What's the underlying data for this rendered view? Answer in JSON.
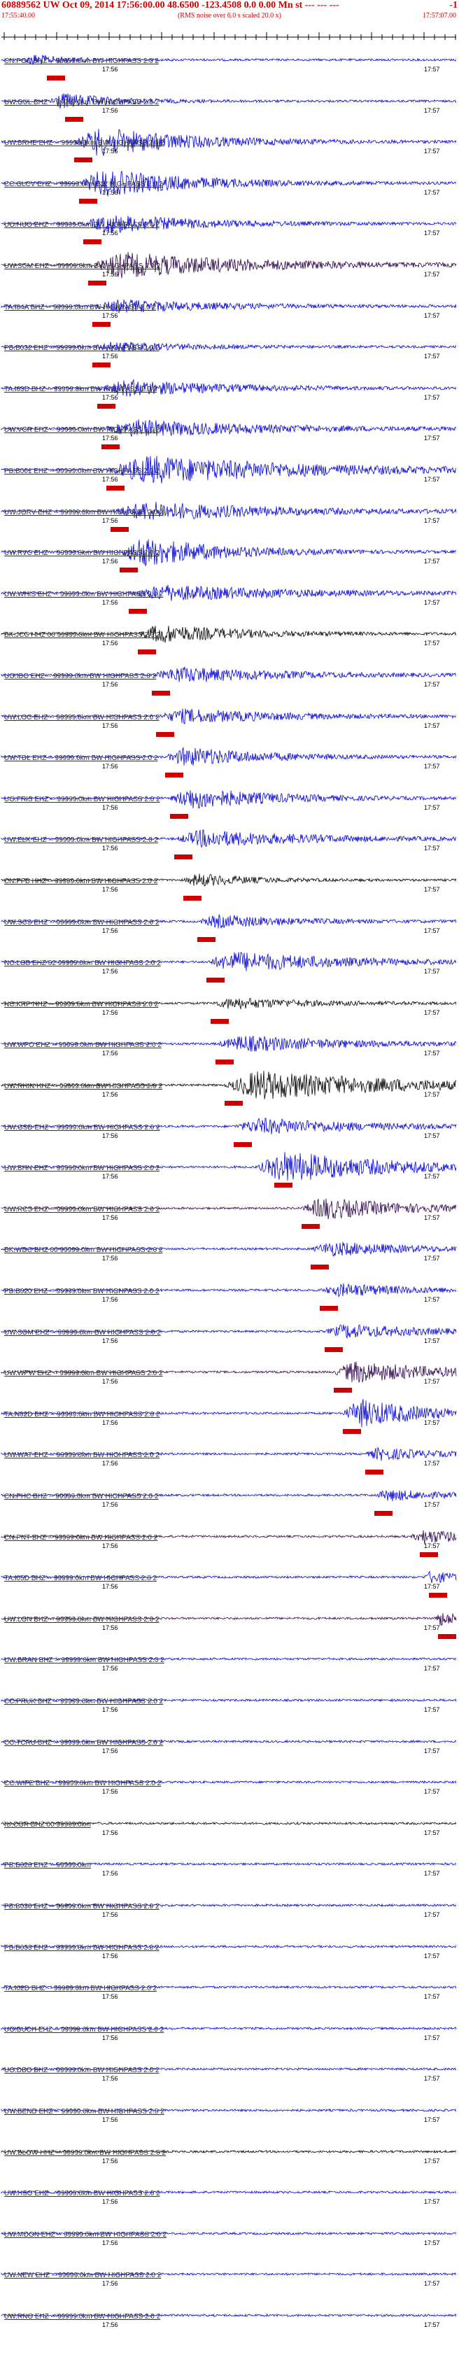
{
  "header": {
    "title": "60889562 UW Oct 09, 2014 17:56:00.00    48.6500 -123.4508   0.0 0.00 Mn st --- --- ---",
    "title_suffix": "-1",
    "start_time": "17:55:40.00",
    "end_time": "17:57:07.00",
    "subtitle": "(RMS noise over 6.0 s scaled 20.0 x)"
  },
  "tick_labels": {
    "left": "17:56",
    "right": "17:57"
  },
  "colors": {
    "blue": "#0000d8",
    "black": "#000000",
    "purple": "#2a004a",
    "red": "#d00000"
  },
  "traces": [
    {
      "label": "CN.PGC BHZ -- 99999.0km BW  HIGHPASS  2.0  2",
      "color": "blue",
      "amp": 0.35,
      "start": 0.05,
      "burst": 0.12,
      "pick": 0.1
    },
    {
      "label": "UW.GUL BHZ -- 99999.0km BW  HIGHPASS  2.0  2",
      "color": "blue",
      "amp": 0.5,
      "start": 0.1,
      "burst": 0.2,
      "pick": 0.14
    },
    {
      "label": "UW.BRHE EHZ -- 99999.0km BW  HIGHPASS  2.0  2",
      "color": "blue",
      "amp": 0.9,
      "start": 0.16,
      "burst": 0.35,
      "pick": 0.16
    },
    {
      "label": "CC.GLCV EHZ -- 99999.0km BW  HIGHPASS  2.0  2",
      "color": "blue",
      "amp": 0.85,
      "start": 0.17,
      "burst": 0.35,
      "pick": 0.17
    },
    {
      "label": "UO.HUO EHZ -- 99999.0km BW  HIGHPASS  2.0  2",
      "color": "blue",
      "amp": 0.6,
      "start": 0.18,
      "burst": 0.35,
      "pick": 0.18
    },
    {
      "label": "UW.SCM EHZ -- 99999.0km BW  HIGHPASS  2.0  2",
      "color": "purple",
      "amp": 0.8,
      "start": 0.19,
      "burst": 0.5,
      "pick": 0.19
    },
    {
      "label": "TA.I04A BHZ -- 99999.0km BW  HIGHPASS  2.0  2",
      "color": "blue",
      "amp": 0.4,
      "start": 0.2,
      "burst": 0.4,
      "pick": 0.2
    },
    {
      "label": "PB.B032 EHZ -- 99999.0km BW  HIGHPASS  2.0  2",
      "color": "blue",
      "amp": 0.3,
      "start": 0.2,
      "burst": 0.3,
      "pick": 0.2
    },
    {
      "label": "TA.I03D BHZ -- 99999.0km BW  HIGHPASS  2.0  2",
      "color": "blue",
      "amp": 0.5,
      "start": 0.21,
      "burst": 0.4,
      "pick": 0.21
    },
    {
      "label": "UW.VCR EHZ -- 99999.0km BW  HIGHPASS  2.0  2",
      "color": "blue",
      "amp": 0.55,
      "start": 0.22,
      "burst": 0.5,
      "pick": 0.22
    },
    {
      "label": "PB.B001 EHZ -- 99999.0km BW  HIGHPASS  2.0  2",
      "color": "blue",
      "amp": 0.9,
      "start": 0.23,
      "burst": 0.6,
      "pick": 0.23
    },
    {
      "label": "UW.JORV EHZ -- 99999.0km BW  HIGHPASS  2.0  2",
      "color": "blue",
      "amp": 0.6,
      "start": 0.24,
      "burst": 0.5,
      "pick": 0.24
    },
    {
      "label": "UW.RVC EHZ -- 99999.0km BW  HIGHPASS  2.0  2",
      "color": "blue",
      "amp": 0.95,
      "start": 0.26,
      "burst": 0.3,
      "pick": 0.26
    },
    {
      "label": "UW.WHIS EHZ -- 99999.0km BW  HIGHPASS  2.0  2",
      "color": "blue",
      "amp": 0.5,
      "start": 0.28,
      "burst": 0.5,
      "pick": 0.28
    },
    {
      "label": "BK.JCC HHZ 00 99999.0km BW  HIGHPASS  2.0  2",
      "color": "black",
      "amp": 0.6,
      "start": 0.3,
      "burst": 0.3,
      "pick": 0.3
    },
    {
      "label": "UO.IBO EHZ -- 99999.0km BW  HIGHPASS  2.0  2",
      "color": "blue",
      "amp": 0.5,
      "start": 0.33,
      "burst": 0.4,
      "pick": 0.33
    },
    {
      "label": "UW.LOC EHZ -- 99999.0km BW  HIGHPASS  2.0  2",
      "color": "blue",
      "amp": 0.45,
      "start": 0.34,
      "burst": 0.4,
      "pick": 0.34
    },
    {
      "label": "UW.TDL EHZ -- 99999.0km BW  HIGHPASS  2.0  2",
      "color": "blue",
      "amp": 0.6,
      "start": 0.36,
      "burst": 0.3,
      "pick": 0.36
    },
    {
      "label": "UO.FRIS EHZ -- 99999.0km BW  HIGHPASS  2.0  2",
      "color": "blue",
      "amp": 0.7,
      "start": 0.37,
      "burst": 0.3,
      "pick": 0.37
    },
    {
      "label": "UW.ELK EHZ -- 99999.0km BW  HIGHPASS  2.0  2",
      "color": "blue",
      "amp": 0.55,
      "start": 0.38,
      "burst": 0.4,
      "pick": 0.38
    },
    {
      "label": "CN.PFB HHZ -- 99999.0km BW  HIGHPASS  2.0  2",
      "color": "black",
      "amp": 0.4,
      "start": 0.4,
      "burst": 0.2,
      "pick": 0.4
    },
    {
      "label": "UW.SCS EHZ -- 99999.0km BW  HIGHPASS  2.0  2",
      "color": "blue",
      "amp": 0.4,
      "start": 0.43,
      "burst": 0.3,
      "pick": 0.43
    },
    {
      "label": "NC.LGB EHZ 02 99999.0km BW  HIGHPASS  2.0  2",
      "color": "blue",
      "amp": 0.65,
      "start": 0.45,
      "burst": 0.4,
      "pick": 0.45
    },
    {
      "label": "NC.KRP HHZ -- 99999.0km BW  HIGHPASS  2.0  2",
      "color": "black",
      "amp": 0.35,
      "start": 0.46,
      "burst": 0.3,
      "pick": 0.46
    },
    {
      "label": "UW.WPO EHZ -- 99999.0km BW  HIGHPASS  2.0  2",
      "color": "blue",
      "amp": 0.5,
      "start": 0.47,
      "burst": 0.4,
      "pick": 0.47
    },
    {
      "label": "UW.RHIN HHZ -- 99999.0km BW  HIGHPASS  2.0  2",
      "color": "black",
      "amp": 0.95,
      "start": 0.49,
      "burst": 0.5,
      "pick": 0.49
    },
    {
      "label": "UW.GSD EHZ -- 99999.0km BW  HIGHPASS  2.0  2",
      "color": "blue",
      "amp": 0.5,
      "start": 0.51,
      "burst": 0.4,
      "pick": 0.51
    },
    {
      "label": "UW.BHN EHZ -- 99999.0km BW  HIGHPASS  2.0  2",
      "color": "blue",
      "amp": 1.0,
      "start": 0.56,
      "burst": 0.4,
      "pick": 0.6
    },
    {
      "label": "UW.RCS EHZ -- 99999.0km BW  HIGHPASS  2.0  2",
      "color": "purple",
      "amp": 0.7,
      "start": 0.66,
      "burst": 0.3,
      "pick": 0.66
    },
    {
      "label": "BK.WDC BHZ 00 99999.0km BW  HIGHPASS  2.0  2",
      "color": "blue",
      "amp": 0.45,
      "start": 0.68,
      "burst": 0.3,
      "pick": 0.68
    },
    {
      "label": "PB.B020 EHZ -- 99999.0km BW  HIGHPASS  2.0  2",
      "color": "blue",
      "amp": 0.4,
      "start": 0.7,
      "burst": 0.3,
      "pick": 0.7
    },
    {
      "label": "UW.SOM EHZ -- 99999.0km BW  HIGHPASS  2.0  2",
      "color": "blue",
      "amp": 0.45,
      "start": 0.71,
      "burst": 0.3,
      "pick": 0.71
    },
    {
      "label": "UW.WPW EHZ -- 99999.0km BW  HIGHPASS  2.0  2",
      "color": "purple",
      "amp": 0.7,
      "start": 0.73,
      "burst": 0.3,
      "pick": 0.73
    },
    {
      "label": "TA.N02D BHZ -- 99999.0km BW  HIGHPASS  2.0  2",
      "color": "blue",
      "amp": 0.9,
      "start": 0.75,
      "burst": 0.25,
      "pick": 0.75
    },
    {
      "label": "UW.WAT EHZ -- 99999.0km BW  HIGHPASS  2.0  2",
      "color": "blue",
      "amp": 0.4,
      "start": 0.8,
      "burst": 0.2,
      "pick": 0.8
    },
    {
      "label": "CN.PHC BHZ -- 99999.0km BW  HIGHPASS  2.0  2",
      "color": "blue",
      "amp": 0.35,
      "start": 0.82,
      "burst": 0.2,
      "pick": 0.82
    },
    {
      "label": "CN.PNT BHZ -- 99999.0km BW  HIGHPASS  2.0  2",
      "color": "purple",
      "amp": 0.45,
      "start": 0.9,
      "burst": 0.2,
      "pick": 0.92
    },
    {
      "label": "TA.I05D BHZ -- 99999.0km BW  HIGHPASS  2.0  2",
      "color": "blue",
      "amp": 0.4,
      "start": 0.93,
      "burst": 0.1,
      "pick": 0.94
    },
    {
      "label": "UW.LON BHZ -- 99999.0km BW  HIGHPASS  2.0  2",
      "color": "purple",
      "amp": 0.45,
      "start": 0.95,
      "burst": 0.1,
      "pick": 0.96
    },
    {
      "label": "UW.BRAN BHZ -- 99999.0km BW  HIGHPASS  2.0  2",
      "color": "blue",
      "amp": 0.3,
      "start": 2,
      "burst": 0.1,
      "pick": null
    },
    {
      "label": "CC.PRUK BHZ -- 99999.0km BW  HIGHPASS  2.0  2",
      "color": "blue",
      "amp": 0.25,
      "start": 2,
      "burst": 0.1,
      "pick": null
    },
    {
      "label": "CC.TCRU BHZ -- 99999.0km BW  HIGHPASS  2.0  2",
      "color": "blue",
      "amp": 0.25,
      "start": 2,
      "burst": 0.1,
      "pick": null
    },
    {
      "label": "CC.WIFE BHZ -- 99999.0km BW  HIGHPASS  2.0  2",
      "color": "blue",
      "amp": 0.25,
      "start": 2,
      "burst": 0.1,
      "pick": null
    },
    {
      "label": "IU.COR BHZ 00 99999.0km",
      "color": "black",
      "amp": 0.05,
      "start": 2,
      "burst": 0.1,
      "pick": null
    },
    {
      "label": "PB.B028 EHZ -- 99999.0km",
      "color": "blue",
      "amp": 0.2,
      "start": 2,
      "burst": 0.1,
      "pick": null
    },
    {
      "label": "PB.B030 EHZ -- 99999.0km BW  HIGHPASS  2.0  2",
      "color": "blue",
      "amp": 0.2,
      "start": 2,
      "burst": 0.1,
      "pick": null
    },
    {
      "label": "PB.B033 EHZ -- 99999.0km BW  HIGHPASS  2.0  2",
      "color": "blue",
      "amp": 0.2,
      "start": 2,
      "burst": 0.1,
      "pick": null
    },
    {
      "label": "TA.I02D BHZ -- 99999.0km BW  HIGHPASS  2.0  2",
      "color": "blue",
      "amp": 0.2,
      "start": 2,
      "burst": 0.1,
      "pick": null
    },
    {
      "label": "UO.BUCH EHZ -- 99999.0km BW  HIGHPASS  2.0  2",
      "color": "blue",
      "amp": 0.2,
      "start": 2,
      "burst": 0.1,
      "pick": null
    },
    {
      "label": "UO.DBO BHZ -- 99999.0km BW  HIGHPASS  2.0  2",
      "color": "blue",
      "amp": 0.2,
      "start": 2,
      "burst": 0.1,
      "pick": null
    },
    {
      "label": "UW.BEND EHZ -- 99999.0km BW  HIGHPASS  2.0  2",
      "color": "blue",
      "amp": 0.2,
      "start": 2,
      "burst": 0.1,
      "pick": null
    },
    {
      "label": "UW.BLOW HHZ -- 99999.0km BW  HIGHPASS  2.0  2",
      "color": "black",
      "amp": 0.25,
      "start": 2,
      "burst": 0.1,
      "pick": null
    },
    {
      "label": "UW.HSO EHZ -- 99999.0km BW  HIGHPASS  2.0  2",
      "color": "blue",
      "amp": 0.2,
      "start": 2,
      "burst": 0.1,
      "pick": null
    },
    {
      "label": "UW.MOON EHZ -- 99999.0km BW  HIGHPASS  2.0  2",
      "color": "blue",
      "amp": 0.2,
      "start": 2,
      "burst": 0.1,
      "pick": null
    },
    {
      "label": "UW.NEW EHZ -- 99999.0km BW  HIGHPASS  2.0  2",
      "color": "blue",
      "amp": 0.2,
      "start": 2,
      "burst": 0.1,
      "pick": null
    },
    {
      "label": "UW.RNO EHZ -- 99999.0km BW  HIGHPASS  2.0  2",
      "color": "blue",
      "amp": 0.2,
      "start": 2,
      "burst": 0.1,
      "pick": null
    }
  ]
}
